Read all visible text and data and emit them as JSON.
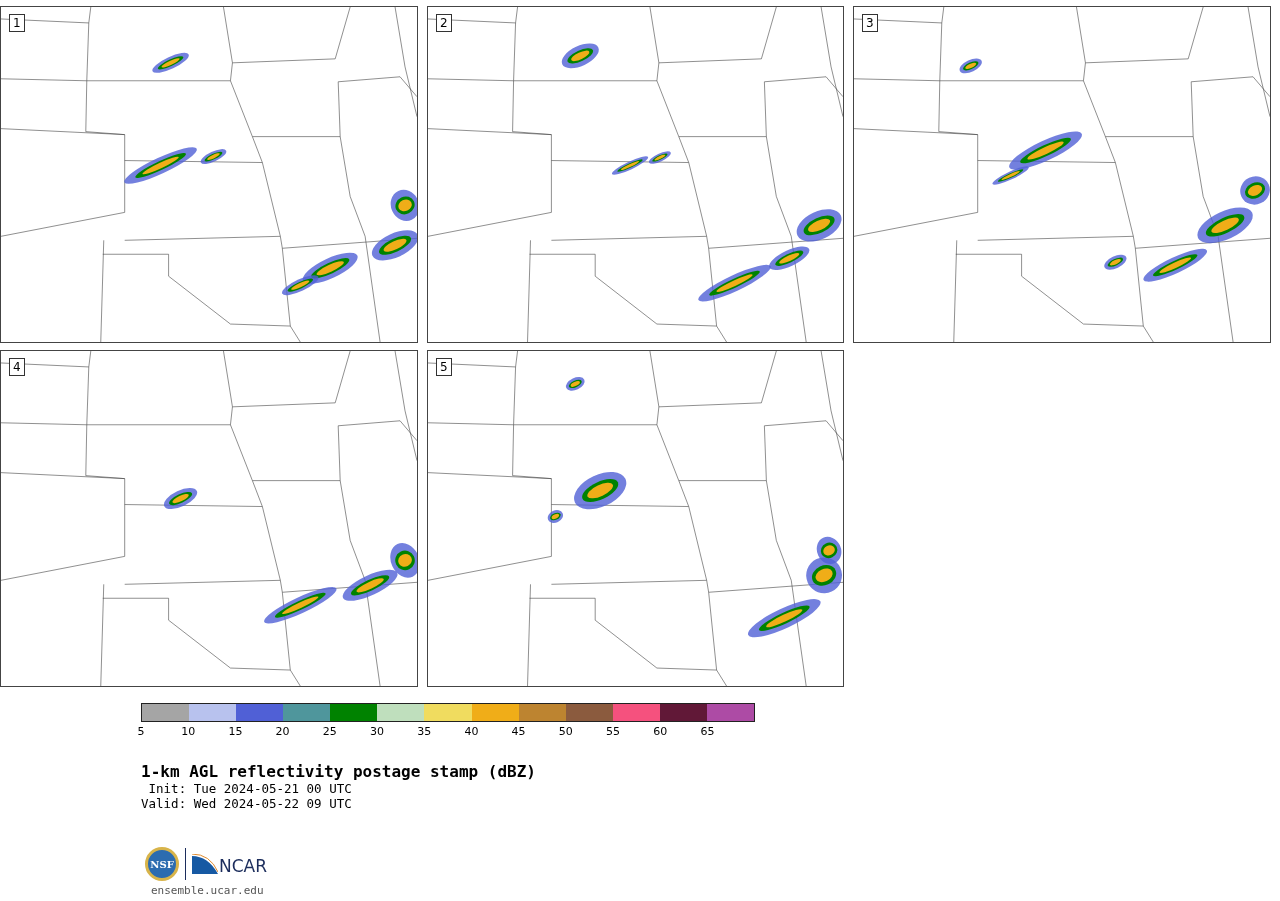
{
  "panels": [
    {
      "label": "1"
    },
    {
      "label": "2"
    },
    {
      "label": "3"
    },
    {
      "label": "4"
    },
    {
      "label": "5"
    }
  ],
  "colorbar": {
    "bins": [
      {
        "color": "#a5a5a5"
      },
      {
        "color": "#b8c2ee"
      },
      {
        "color": "#5060d6"
      },
      {
        "color": "#4f969c"
      },
      {
        "color": "#008200"
      },
      {
        "color": "#bfdfbd"
      },
      {
        "color": "#f0dc5f"
      },
      {
        "color": "#f0ad18"
      },
      {
        "color": "#bd8430"
      },
      {
        "color": "#8b5b3e"
      },
      {
        "color": "#f5517e"
      },
      {
        "color": "#611837"
      },
      {
        "color": "#ad4ba5"
      }
    ],
    "ticks": [
      "5",
      "10",
      "15",
      "20",
      "25",
      "30",
      "35",
      "40",
      "45",
      "50",
      "55",
      "60",
      "65"
    ]
  },
  "title": "1-km AGL reflectivity postage stamp (dBZ)",
  "init": " Init: Tue 2024-05-21 00 UTC",
  "valid": "Valid: Wed 2024-05-22 09 UTC",
  "logo": {
    "left": "NSF",
    "right": "NCAR"
  },
  "url": "ensemble.ucar.edu"
}
